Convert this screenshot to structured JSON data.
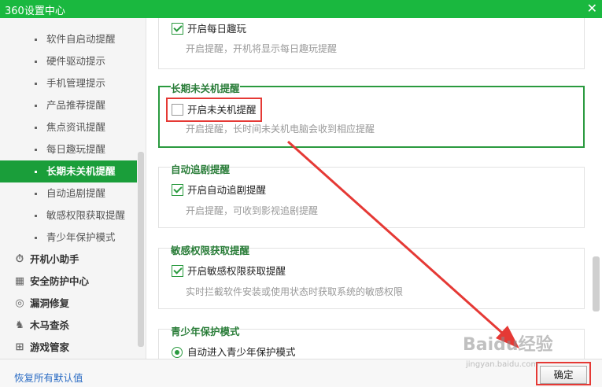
{
  "window": {
    "title": "360设置中心",
    "close_glyph": "✕"
  },
  "sidebar": {
    "sub_items": [
      {
        "label": "软件自启动提醒",
        "active": false
      },
      {
        "label": "硬件驱动提示",
        "active": false
      },
      {
        "label": "手机管理提示",
        "active": false
      },
      {
        "label": "产品推荐提醒",
        "active": false
      },
      {
        "label": "焦点资讯提醒",
        "active": false
      },
      {
        "label": "每日趣玩提醒",
        "active": false
      },
      {
        "label": "长期未关机提醒",
        "active": true
      },
      {
        "label": "自动追剧提醒",
        "active": false
      },
      {
        "label": "敏感权限获取提醒",
        "active": false
      },
      {
        "label": "青少年保护模式",
        "active": false
      }
    ],
    "main_items": [
      {
        "label": "开机小助手",
        "icon": "clock-icon",
        "glyph": "⏱"
      },
      {
        "label": "安全防护中心",
        "icon": "grid-icon",
        "glyph": "▦"
      },
      {
        "label": "漏洞修复",
        "icon": "shield-icon",
        "glyph": "◎"
      },
      {
        "label": "木马查杀",
        "icon": "horse-icon",
        "glyph": "♞"
      },
      {
        "label": "游戏管家",
        "icon": "gamepad-icon",
        "glyph": "⊞"
      }
    ]
  },
  "content": {
    "sections": [
      {
        "title": "",
        "option": "开启每日趣玩",
        "checked": true,
        "control": "checkbox",
        "desc": "开启提醒，开机将显示每日趣玩提醒"
      },
      {
        "title": "长期未关机提醒",
        "option": "开启未关机提醒",
        "checked": false,
        "control": "checkbox",
        "desc": "开启提醒，长时间未关机电脑会收到相应提醒",
        "highlighted": true
      },
      {
        "title": "自动追剧提醒",
        "option": "开启自动追剧提醒",
        "checked": true,
        "control": "checkbox",
        "desc": "开启提醒，可收到影视追剧提醒"
      },
      {
        "title": "敏感权限获取提醒",
        "option": "开启敏感权限获取提醒",
        "checked": true,
        "control": "checkbox",
        "desc": "实时拦截软件安装或使用状态时获取系统的敏感权限"
      },
      {
        "title": "青少年保护模式",
        "option": "自动进入青少年保护模式",
        "checked": true,
        "control": "radio",
        "desc": ""
      }
    ]
  },
  "footer": {
    "restore_label": "恢复所有默认值",
    "ok_label": "确定"
  },
  "watermark": {
    "text": "Baidu经验",
    "url": "jingyan.baidu.com"
  },
  "colors": {
    "titlebar": "#1ab83f",
    "accent_green": "#2a9a3f",
    "active_item": "#1a9e3a",
    "annotation_red": "#e53935",
    "link": "#2b6cc4"
  }
}
